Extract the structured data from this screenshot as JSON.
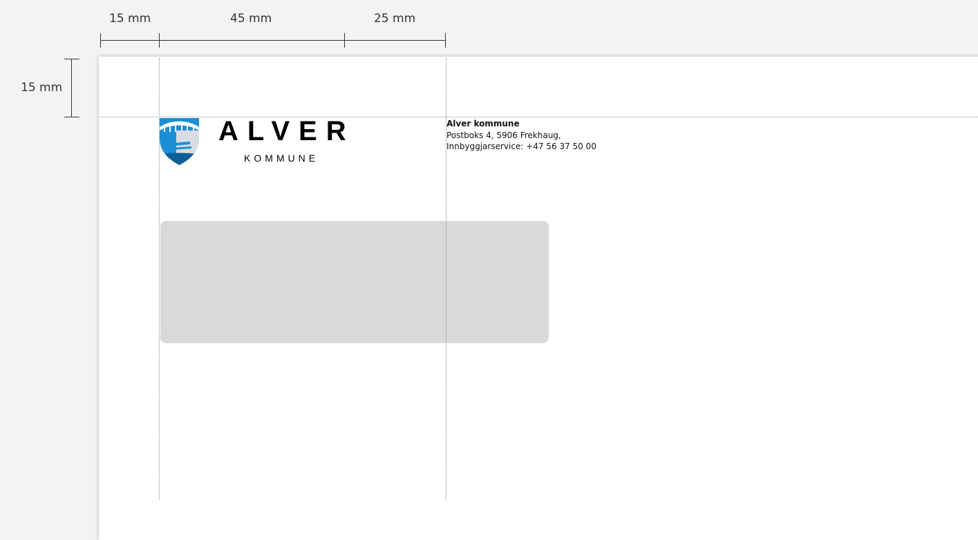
{
  "dimensions": {
    "left_margin": "15 mm",
    "logo_width": "45 mm",
    "gap_width": "25 mm",
    "top_margin": "15 mm"
  },
  "logo": {
    "wordmark": "ALVER",
    "subtitle": "KOMMUNE",
    "shield_colors": {
      "blue": "#1b8ed6",
      "bridge": "#ffffff",
      "dark": "#0d5e99"
    }
  },
  "sender": {
    "name": "Alver kommune",
    "address": "Postboks 4, 5906 Frekhaug,",
    "service": "Innbyggjarservice: +47 56 37 50 00"
  },
  "colors": {
    "background": "#f3f3f3",
    "paper": "#ffffff",
    "address_window": "#d9d9d9"
  }
}
